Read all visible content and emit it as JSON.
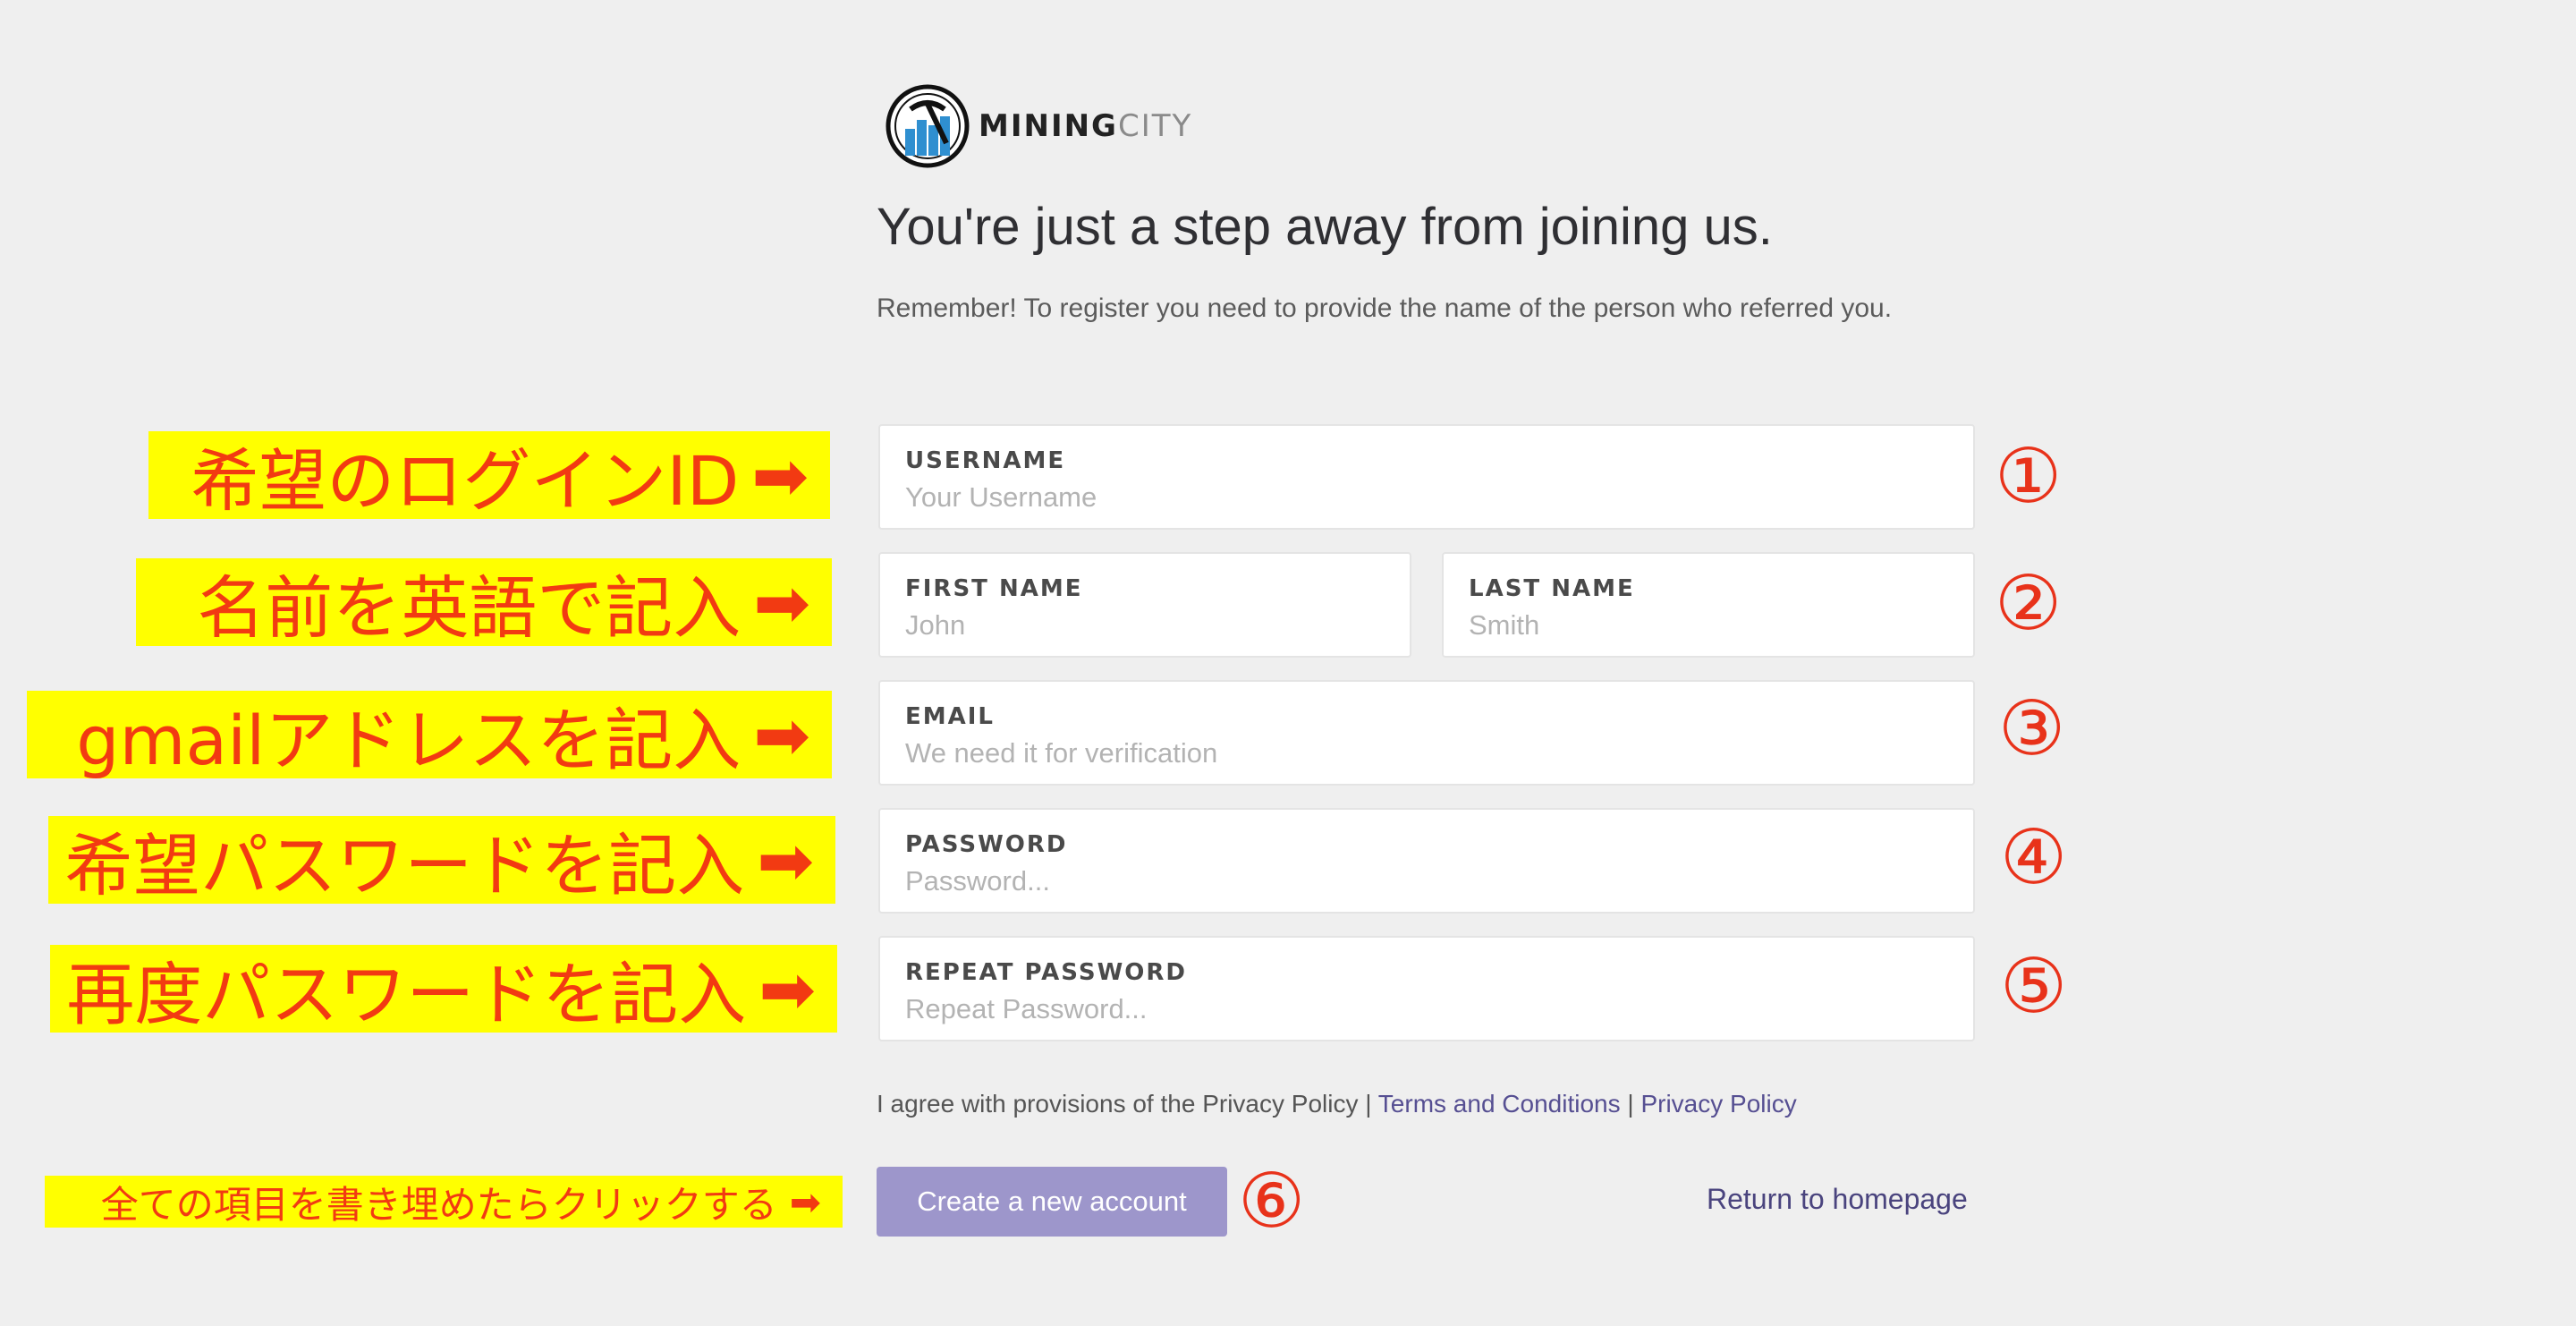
{
  "logo": {
    "text_primary": "MINING",
    "text_secondary": "CITY"
  },
  "headline": "You're just a step away from joining us.",
  "subtext": "Remember! To register you need to provide the name of the person who referred you.",
  "form": {
    "username": {
      "label": "USERNAME",
      "placeholder": "Your Username"
    },
    "first_name": {
      "label": "FIRST NAME",
      "placeholder": "John"
    },
    "last_name": {
      "label": "LAST NAME",
      "placeholder": "Smith"
    },
    "email": {
      "label": "EMAIL",
      "placeholder": "We need it for verification"
    },
    "password": {
      "label": "PASSWORD",
      "placeholder": "Password..."
    },
    "repeat_password": {
      "label": "REPEAT PASSWORD",
      "placeholder": "Repeat Password..."
    }
  },
  "agree": {
    "text": "I agree with provisions of the Privacy Policy",
    "sep": "|",
    "terms": "Terms and Conditions",
    "privacy": "Privacy Policy"
  },
  "actions": {
    "create": "Create a new account",
    "return": "Return to homepage"
  },
  "annotations": {
    "n1": "希望のログインID",
    "n2": "名前を英語で記入",
    "n3": "gmailアドレスを記入",
    "n4": "希望パスワードを記入",
    "n5": "再度パスワードを記入",
    "n6": "全ての項目を書き埋めたらクリックする",
    "arrow": "➡",
    "c1": "①",
    "c2": "②",
    "c3": "③",
    "c4": "④",
    "c5": "⑤",
    "c6": "⑥"
  },
  "colors": {
    "accent": "#9d96cb",
    "link": "#564f92",
    "annotation_bg": "#ffff00",
    "annotation_text": "#f23a12"
  }
}
